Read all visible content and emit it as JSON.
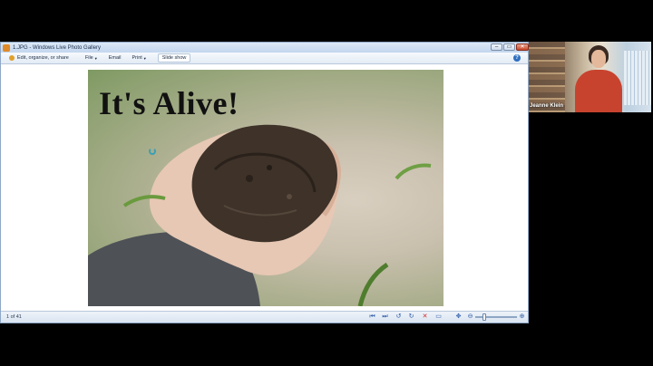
{
  "window": {
    "title": "1.JPG - Windows Live Photo Gallery",
    "controls": {
      "minimize": "–",
      "maximize": "▭",
      "close": "✕"
    }
  },
  "toolbar": {
    "edit_label": "Edit, organize, or share",
    "file_label": "File",
    "email_label": "Email",
    "print_label": "Print",
    "slideshow_label": "Slide show",
    "help": "?"
  },
  "photo": {
    "caption": "It's Alive!"
  },
  "statusbar": {
    "count": "1 of 41",
    "icons": [
      "prev-icon",
      "next-icon",
      "rotate-left-icon",
      "rotate-right-icon",
      "delete-icon",
      "display-icon",
      "actual-size-icon",
      "zoom-out-icon",
      "zoom-in-icon"
    ],
    "zoom_level": 0.2
  },
  "webcam": {
    "participant_name": "Jeanne Klein"
  },
  "colors": {
    "window_border": "#8fa8c8",
    "close_button": "#c7462a",
    "accent": "#2b5aa8",
    "delete_icon": "#d02a2a"
  }
}
